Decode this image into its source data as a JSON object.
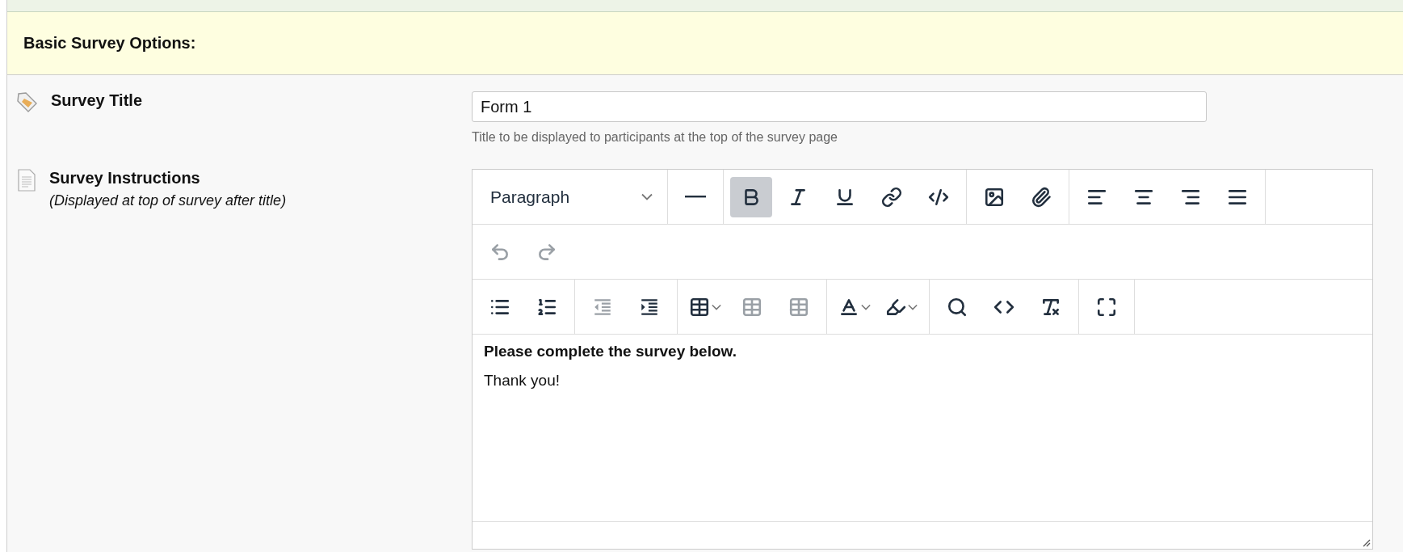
{
  "section": {
    "title": "Basic Survey Options:"
  },
  "fields": [
    {
      "kind": "text",
      "label": "Survey Title",
      "value": "Form 1",
      "hint": "Title to be displayed to participants at the top of the survey page"
    },
    {
      "kind": "editor",
      "label": "Survey Instructions",
      "sublabel": "(Displayed at top of survey after title)"
    }
  ],
  "toolbar": {
    "rows": [
      {
        "groups": [
          {
            "buttons": [
              {
                "kind": "select",
                "value": "Paragraph"
              }
            ]
          },
          {
            "buttons": [
              {
                "kind": "button",
                "selected": false,
                "disabled": false
              }
            ]
          },
          {
            "buttons": [
              {
                "kind": "button",
                "selected": true,
                "disabled": false
              },
              {
                "kind": "button",
                "selected": false,
                "disabled": false
              },
              {
                "kind": "button",
                "selected": false,
                "disabled": false
              },
              {
                "kind": "button",
                "selected": false,
                "disabled": false
              },
              {
                "kind": "button",
                "selected": false,
                "disabled": false
              }
            ]
          },
          {
            "buttons": [
              {
                "kind": "button",
                "selected": false,
                "disabled": false
              },
              {
                "kind": "button",
                "selected": false,
                "disabled": false
              }
            ]
          },
          {
            "buttons": [
              {
                "kind": "button",
                "selected": false,
                "disabled": false
              },
              {
                "kind": "button",
                "selected": false,
                "disabled": false
              },
              {
                "kind": "button",
                "selected": false,
                "disabled": false
              },
              {
                "kind": "button",
                "selected": false,
                "disabled": false
              }
            ]
          }
        ]
      },
      {
        "groups": [
          {
            "buttons": [
              {
                "kind": "button",
                "selected": false,
                "disabled": true
              },
              {
                "kind": "button",
                "selected": false,
                "disabled": true
              }
            ]
          }
        ]
      },
      {
        "groups": [
          {
            "buttons": [
              {
                "kind": "button",
                "selected": false,
                "disabled": false
              },
              {
                "kind": "button",
                "selected": false,
                "disabled": false
              }
            ]
          },
          {
            "buttons": [
              {
                "kind": "button",
                "selected": false,
                "disabled": true
              },
              {
                "kind": "button",
                "selected": false,
                "disabled": false
              }
            ]
          },
          {
            "buttons": [
              {
                "kind": "split",
                "selected": false,
                "disabled": false
              },
              {
                "kind": "button",
                "selected": false,
                "disabled": true
              },
              {
                "kind": "button",
                "selected": false,
                "disabled": true
              }
            ]
          },
          {
            "buttons": [
              {
                "kind": "split",
                "selected": false,
                "disabled": false
              },
              {
                "kind": "split",
                "selected": false,
                "disabled": false
              }
            ]
          },
          {
            "buttons": [
              {
                "kind": "button",
                "selected": false,
                "disabled": false
              },
              {
                "kind": "button",
                "selected": false,
                "disabled": false
              },
              {
                "kind": "button",
                "selected": false,
                "disabled": false
              }
            ]
          },
          {
            "buttons": [
              {
                "kind": "button",
                "selected": false,
                "disabled": false
              }
            ]
          }
        ]
      }
    ]
  },
  "content": [
    {
      "text": "Please complete the survey below.",
      "bold": true
    },
    {
      "text": "Thank you!",
      "bold": false
    }
  ]
}
